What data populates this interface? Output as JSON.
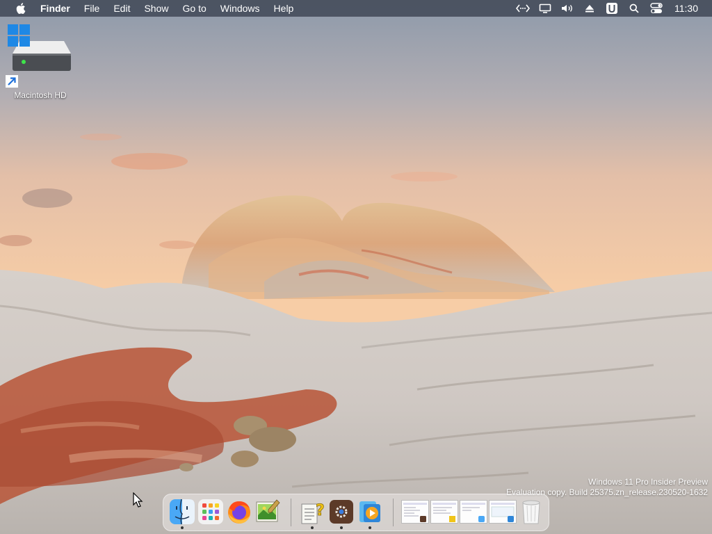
{
  "menubar": {
    "apple_icon": "apple-logo-icon",
    "app_name": "Finder",
    "menus": [
      "File",
      "Edit",
      "Show",
      "Go to",
      "Windows",
      "Help"
    ],
    "status_icons": [
      "code-brackets-icon",
      "display-icon",
      "volume-icon",
      "eject-icon",
      "u-badge-icon",
      "search-icon",
      "control-center-icon"
    ],
    "clock": "11:30"
  },
  "desktop": {
    "drive_label": "Macintosh HD",
    "drive_icon": "hard-drive-icon",
    "windows_badge_icon": "windows-logo-icon",
    "shortcut_icon": "shortcut-arrow-icon"
  },
  "watermark": {
    "line1": "Windows 11 Pro Insider Preview",
    "line2": "Evaluation copy. Build 25375.zn_release.230520-1632"
  },
  "dock": {
    "apps": [
      {
        "name": "finder-icon",
        "running": true
      },
      {
        "name": "launchpad-icon",
        "running": false
      },
      {
        "name": "firefox-icon",
        "running": false
      },
      {
        "name": "image-editor-icon",
        "running": false
      },
      {
        "name": "help-notes-icon",
        "running": true
      },
      {
        "name": "settings-gear-icon",
        "running": true
      },
      {
        "name": "media-player-icon",
        "running": true
      }
    ],
    "windows": [
      "window-thumbnail-1",
      "window-thumbnail-2",
      "window-thumbnail-3",
      "window-thumbnail-4"
    ],
    "trash_icon": "trash-icon"
  },
  "colors": {
    "menubar": "#464e5c",
    "sky_top": "#8e9aab",
    "sky_horizon": "#f6c9a0",
    "rock": "#d4cdc6",
    "red_sand": "#b8553a"
  }
}
